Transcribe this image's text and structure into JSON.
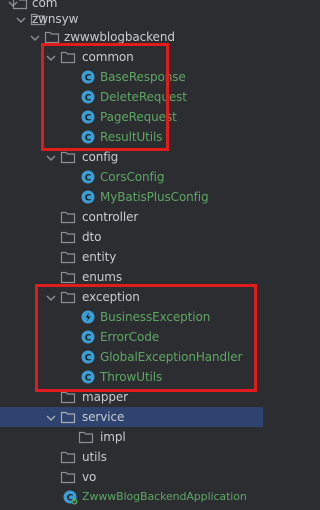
{
  "colors": {
    "background": "#2b2d30",
    "package_text": "#c9cbd1",
    "class_text": "#5fa665",
    "selection": "#2e436e",
    "highlight_border": "#e21c1c",
    "folder_icon": "#8c9096",
    "class_icon": "#3a9fd6",
    "exception_icon": "#3a9fd6",
    "app_icon": "#3a9fd6"
  },
  "tree": [
    {
      "label": "com",
      "type": "folder",
      "expanded": true,
      "selected": false
    },
    {
      "label": "zwnsyw",
      "type": "folder",
      "expanded": true,
      "selected": false
    },
    {
      "label": "zwwwblogbackend",
      "type": "folder",
      "expanded": true,
      "selected": false
    },
    {
      "label": "common",
      "type": "folder",
      "expanded": true,
      "selected": false
    },
    {
      "label": "BaseResponse",
      "type": "class",
      "icon": "class-icon",
      "selected": false
    },
    {
      "label": "DeleteRequest",
      "type": "class",
      "icon": "class-icon",
      "selected": false
    },
    {
      "label": "PageRequest",
      "type": "class",
      "icon": "class-icon",
      "selected": false
    },
    {
      "label": "ResultUtils",
      "type": "class",
      "icon": "class-icon",
      "selected": false
    },
    {
      "label": "config",
      "type": "folder",
      "expanded": true,
      "selected": false
    },
    {
      "label": "CorsConfig",
      "type": "class",
      "icon": "class-icon",
      "selected": false
    },
    {
      "label": "MyBatisPlusConfig",
      "type": "class",
      "icon": "class-icon",
      "selected": false
    },
    {
      "label": "controller",
      "type": "folder",
      "expanded": false,
      "selected": false
    },
    {
      "label": "dto",
      "type": "folder",
      "expanded": false,
      "selected": false
    },
    {
      "label": "entity",
      "type": "folder",
      "expanded": false,
      "selected": false
    },
    {
      "label": "enums",
      "type": "folder",
      "expanded": false,
      "selected": false
    },
    {
      "label": "exception",
      "type": "folder",
      "expanded": true,
      "selected": false
    },
    {
      "label": "BusinessException",
      "type": "class",
      "icon": "exception-class-icon",
      "selected": false
    },
    {
      "label": "ErrorCode",
      "type": "class",
      "icon": "class-icon",
      "selected": false
    },
    {
      "label": "GlobalExceptionHandler",
      "type": "class",
      "icon": "class-icon",
      "selected": false
    },
    {
      "label": "ThrowUtils",
      "type": "class",
      "icon": "class-icon",
      "selected": false
    },
    {
      "label": "mapper",
      "type": "folder",
      "expanded": false,
      "selected": false
    },
    {
      "label": "service",
      "type": "folder",
      "expanded": true,
      "selected": true
    },
    {
      "label": "impl",
      "type": "folder",
      "expanded": false,
      "selected": false
    },
    {
      "label": "utils",
      "type": "folder",
      "expanded": false,
      "selected": false
    },
    {
      "label": "vo",
      "type": "folder",
      "expanded": false,
      "selected": false
    },
    {
      "label": "ZwwwBlogBackendApplication",
      "type": "class",
      "icon": "spring-boot-app-icon",
      "selected": false
    }
  ]
}
